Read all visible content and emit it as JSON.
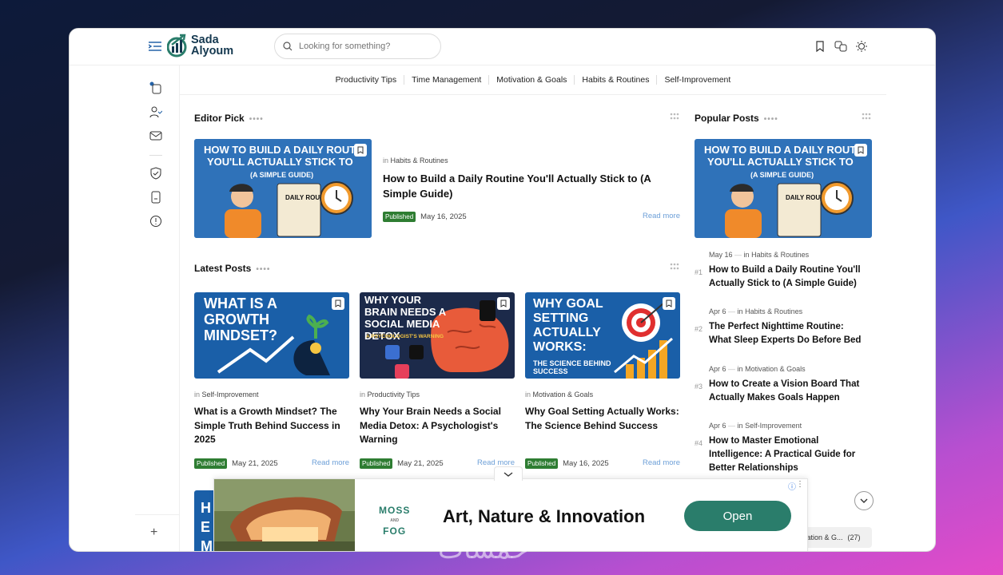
{
  "logo": {
    "line1": "Sada",
    "line2": "Alyoum"
  },
  "search": {
    "placeholder": "Looking for something?"
  },
  "categories": [
    "Productivity Tips",
    "Time Management",
    "Motivation & Goals",
    "Habits & Routines",
    "Self-Improvement"
  ],
  "editor_pick": {
    "title": "Editor Pick",
    "thumb_lines": [
      "HOW TO BUILD A DAILY ROUTINE",
      "YOU'LL ACTUALLY STICK TO",
      "(A SIMPLE GUIDE)"
    ],
    "thumb_short": [
      "HOW TO BUILD A DAILY ROUTI",
      "YOU'LL ACTUALLY STICK TO"
    ],
    "thumb_sub": "(A SIMPLE GUIDE)",
    "clip_label": "DAILY ROUTINE",
    "in": "in",
    "category": "Habits & Routines",
    "post_title": "How to Build a Daily Routine You'll Actually Stick to (A Simple Guide)",
    "badge": "Published",
    "date": "May 16, 2025",
    "read_more": "Read more"
  },
  "latest": {
    "title": "Latest Posts",
    "posts": [
      {
        "thumb": "WHAT IS A GROWTH MINDSET?",
        "category": "Self-Improvement",
        "title": "What is a Growth Mindset? The Simple Truth Behind Success in 2025",
        "badge": "Published",
        "date": "May 21, 2025",
        "read_more": "Read more"
      },
      {
        "thumb": "WHY YOUR BRAIN NEEDS A SOCIAL MEDIA DETOX",
        "thumb_sub": "A PSYCHOLOGIST'S WARNING",
        "category": "Productivity Tips",
        "title": "Why Your Brain Needs a Social Media Detox: A Psychologist's Warning",
        "badge": "Published",
        "date": "May 21, 2025",
        "read_more": "Read more"
      },
      {
        "thumb": "WHY GOAL SETTING ACTUALLY WORKS:",
        "thumb_sub": "THE SCIENCE BEHIND SUCCESS",
        "category": "Motivation & Goals",
        "title": "Why Goal Setting Actually Works: The Science Behind Success",
        "badge": "Published",
        "date": "May 16, 2025",
        "read_more": "Read more"
      }
    ]
  },
  "popular": {
    "title": "Popular Posts",
    "posts": [
      {
        "num": "#1",
        "date": "May 16",
        "category": "Habits & Routines",
        "title": "How to Build a Daily Routine You'll Actually Stick to (A Simple Guide)"
      },
      {
        "num": "#2",
        "date": "Apr 6",
        "category": "Habits & Routines",
        "title": "The Perfect Nighttime Routine: What Sleep Experts Do Before Bed"
      },
      {
        "num": "#3",
        "date": "Apr 6",
        "category": "Motivation & Goals",
        "title": "How to Create a Vision Board That Actually Makes Goals Happen"
      },
      {
        "num": "#4",
        "date": "Apr 6",
        "category": "Self-Improvement",
        "title": "How to Master Emotional Intelligence: A Practical Guide for Better Relationships"
      }
    ],
    "sep": "—",
    "in": "in"
  },
  "ad": {
    "brand_line1": "MOSS",
    "brand_and": "AND",
    "brand_line2": "FOG",
    "headline": "Art, Nature & Innovation",
    "cta": "Open",
    "info": "ⓘ",
    "more": "⋮"
  },
  "category_chip": {
    "label": "ivation & G...",
    "count": "(27)"
  },
  "partial_card_text": [
    "H",
    "E",
    "M"
  ],
  "watermark": "خمسات",
  "colors": {
    "accent": "#2a7d6b",
    "badge": "#2e7d32",
    "thumb_blue": "#1a5fa8",
    "link": "#6ea0d8"
  }
}
